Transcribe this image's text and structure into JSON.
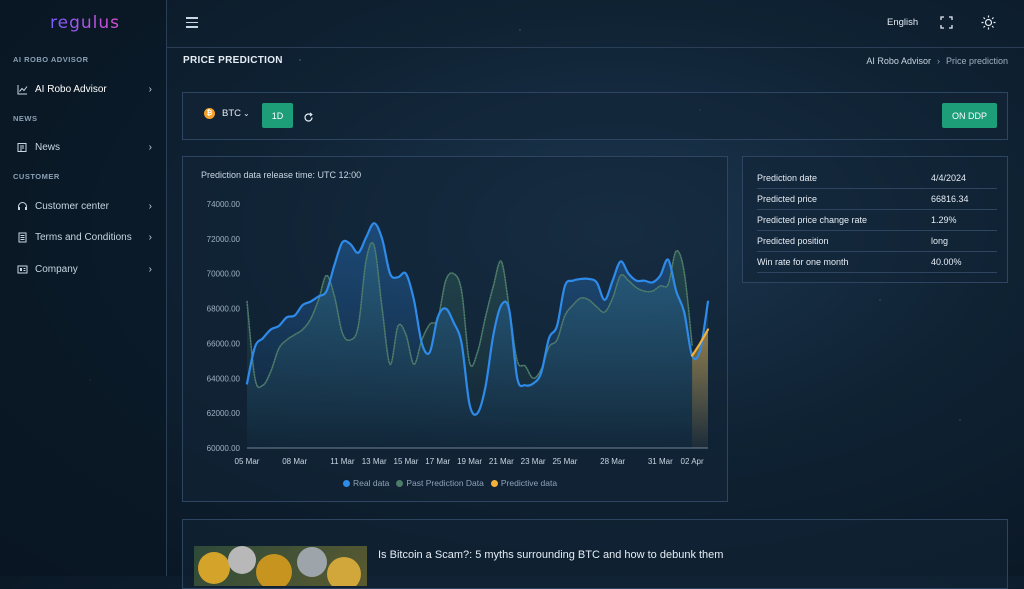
{
  "brand": {
    "logo": "regulus"
  },
  "sidebar": {
    "sections": [
      {
        "title": "AI ROBO ADVISOR",
        "items": [
          {
            "label": "AI Robo Advisor",
            "icon": "chart-line-icon"
          }
        ]
      },
      {
        "title": "NEWS",
        "items": [
          {
            "label": "News",
            "icon": "newspaper-icon"
          }
        ]
      },
      {
        "title": "CUSTOMER",
        "items": [
          {
            "label": "Customer center",
            "icon": "headset-icon"
          },
          {
            "label": "Terms and Conditions",
            "icon": "document-icon"
          },
          {
            "label": "Company",
            "icon": "building-icon"
          }
        ]
      }
    ]
  },
  "topbar": {
    "language": "English"
  },
  "page": {
    "title": "PRICE PREDICTION"
  },
  "breadcrumb": {
    "parent": "AI Robo Advisor",
    "current": "Price prediction"
  },
  "controls": {
    "coin": "BTC",
    "interval": "1D",
    "action": "ON DDP"
  },
  "chart_panel": {
    "release_text": "Prediction data release time: UTC 12:00"
  },
  "chart_data": {
    "type": "line",
    "ylim": [
      60000,
      74000
    ],
    "y_ticks": [
      "74000.00",
      "72000.00",
      "70000.00",
      "68000.00",
      "66000.00",
      "64000.00",
      "62000.00",
      "60000.00"
    ],
    "x_tick_labels": [
      "05 Mar",
      "08 Mar",
      "11 Mar",
      "13 Mar",
      "15 Mar",
      "17 Mar",
      "19 Mar",
      "21 Mar",
      "23 Mar",
      "25 Mar",
      "28 Mar",
      "31 Mar",
      "02 Apr"
    ],
    "x_tick_days": [
      5,
      8,
      11,
      13,
      15,
      17,
      19,
      21,
      23,
      25,
      28,
      31,
      33
    ],
    "colors": {
      "real": "#2e8bea",
      "past": "#4e7b6a",
      "predictive": "#f2b13b"
    },
    "series": [
      {
        "name": "Real data",
        "x": [
          5,
          5.5,
          6,
          6.5,
          7,
          7.5,
          8,
          8.5,
          9,
          9.5,
          10,
          10.5,
          11,
          11.5,
          12,
          12.5,
          13,
          13.5,
          14,
          14.5,
          15,
          15.5,
          16,
          16.5,
          17,
          17.5,
          18,
          18.5,
          19,
          19.5,
          20,
          20.5,
          21,
          21.5,
          22,
          22.5,
          23,
          23.5,
          24,
          24.5,
          25,
          25.5,
          26,
          26.5,
          27,
          27.5,
          28,
          28.5,
          29,
          29.5,
          30,
          30.5,
          31,
          31.5,
          32,
          32.5,
          33,
          33.5,
          34
        ],
        "y": [
          63700,
          65800,
          66300,
          66800,
          67000,
          67500,
          67600,
          68200,
          68400,
          68700,
          69000,
          70500,
          71800,
          71700,
          71200,
          72100,
          72900,
          72000,
          70000,
          69800,
          70000,
          68500,
          66000,
          65500,
          67500,
          68000,
          67200,
          66000,
          62500,
          62000,
          63500,
          66500,
          68200,
          67900,
          64000,
          63600,
          63700,
          64300,
          66300,
          67000,
          69300,
          69600,
          69700,
          69700,
          69500,
          68500,
          69600,
          70700,
          70000,
          69600,
          69600,
          69500,
          69900,
          70800,
          69000,
          67800,
          65300,
          65600,
          68400
        ]
      },
      {
        "name": "Past Prediction Data",
        "x": [
          5,
          5.5,
          6,
          6.5,
          7,
          7.5,
          8,
          8.5,
          9,
          9.5,
          10,
          10.5,
          11,
          11.5,
          12,
          12.5,
          13,
          13.5,
          14,
          14.5,
          15,
          15.5,
          16,
          16.5,
          17,
          17.5,
          18,
          18.5,
          19,
          19.5,
          20,
          20.5,
          21,
          21.5,
          22,
          22.5,
          23,
          23.5,
          24,
          24.5,
          25,
          25.5,
          26,
          26.5,
          27,
          27.5,
          28,
          28.5,
          29,
          29.5,
          30,
          30.5,
          31,
          31.5,
          32,
          32.5,
          33
        ],
        "y": [
          68400,
          64000,
          63600,
          64400,
          65700,
          66200,
          66500,
          66800,
          67400,
          68500,
          69900,
          68700,
          66600,
          66200,
          67000,
          70800,
          71600,
          68000,
          64800,
          67000,
          66500,
          64800,
          66200,
          67100,
          67400,
          69600,
          70000,
          69000,
          64900,
          65500,
          67500,
          69300,
          70700,
          68000,
          65000,
          64700,
          64000,
          64500,
          65800,
          66200,
          67600,
          68200,
          68600,
          68500,
          68100,
          67800,
          68600,
          69900,
          69600,
          69200,
          69000,
          69000,
          69300,
          69400,
          71300,
          70100,
          65900
        ]
      },
      {
        "name": "Predictive data",
        "x": [
          33,
          33.5,
          34
        ],
        "y": [
          65300,
          66000,
          66800
        ]
      }
    ]
  },
  "prediction": {
    "rows": [
      {
        "label": "Prediction date",
        "value": "4/4/2024"
      },
      {
        "label": "Predicted price",
        "value": "66816.34"
      },
      {
        "label": "Predicted price change rate",
        "value": "1.29%"
      },
      {
        "label": "Predicted position",
        "value": "long"
      },
      {
        "label": "Win rate for one month",
        "value": "40.00%"
      }
    ]
  },
  "news": {
    "title": "Is Bitcoin a Scam?: 5 myths surrounding BTC and how to debunk them"
  }
}
